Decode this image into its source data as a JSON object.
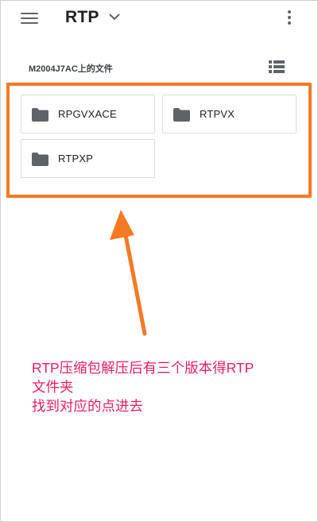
{
  "appbar": {
    "title": "RTP",
    "menu_icon": "hamburger-menu-icon",
    "dropdown_icon": "chevron-down-icon",
    "more_icon": "more-vert-icon"
  },
  "location": {
    "label": "M2004J7AC上的文件",
    "view_toggle_icon": "list-view-icon"
  },
  "folders": [
    {
      "name": "RPGVXACE",
      "icon": "folder-icon"
    },
    {
      "name": "RTPVX",
      "icon": "folder-icon"
    },
    {
      "name": "RTPXP",
      "icon": "folder-icon"
    }
  ],
  "annotation": {
    "line1": "RTP压缩包解压后有三个版本得RTP",
    "line2": "文件夹",
    "line3": "找到对应的点进去",
    "color": "#e91e63"
  },
  "colors": {
    "highlight": "#f47a24",
    "icon": "#5f6368"
  }
}
